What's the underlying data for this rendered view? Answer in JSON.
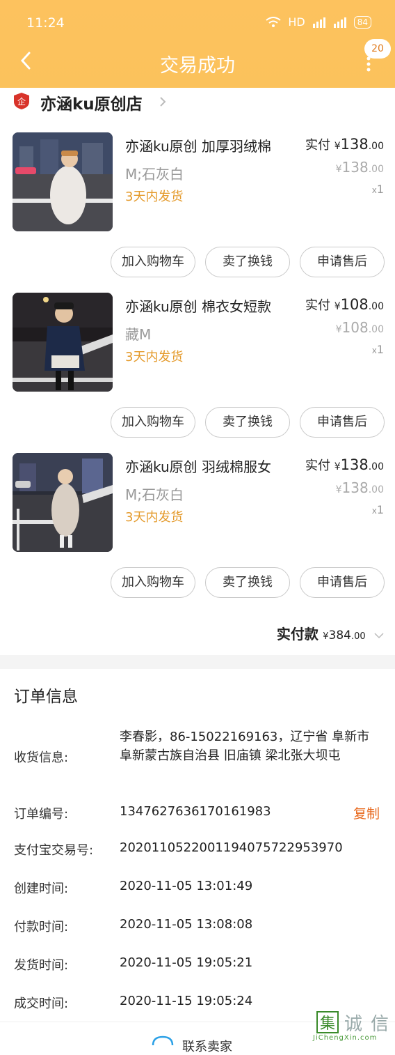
{
  "status_bar": {
    "time": "11:24",
    "network": "HD",
    "battery": "84"
  },
  "header": {
    "title": "交易成功",
    "badge": "20"
  },
  "shop": {
    "name": "亦涵ku原创店"
  },
  "items": [
    {
      "name": "亦涵ku原创 加厚羽绒棉",
      "spec": "M;石灰白",
      "ship": "3天内发货",
      "paid_label": "实付",
      "paid_int": "138",
      "paid_dec": ".00",
      "orig_int": "138",
      "orig_dec": ".00",
      "qty": "1",
      "btn_cart": "加入购物车",
      "btn_sell": "卖了换钱",
      "btn_after": "申请售后"
    },
    {
      "name": "亦涵ku原创 棉衣女短款",
      "spec": "藏M",
      "ship": "3天内发货",
      "paid_label": "实付",
      "paid_int": "108",
      "paid_dec": ".00",
      "orig_int": "108",
      "orig_dec": ".00",
      "qty": "1",
      "btn_cart": "加入购物车",
      "btn_sell": "卖了换钱",
      "btn_after": "申请售后"
    },
    {
      "name": "亦涵ku原创 羽绒棉服女",
      "spec": "M;石灰白",
      "ship": "3天内发货",
      "paid_label": "实付",
      "paid_int": "138",
      "paid_dec": ".00",
      "orig_int": "138",
      "orig_dec": ".00",
      "qty": "1",
      "btn_cart": "加入购物车",
      "btn_sell": "卖了换钱",
      "btn_after": "申请售后"
    }
  ],
  "currency": "¥",
  "qty_prefix": "x",
  "total": {
    "label": "实付款",
    "amount_int": "384",
    "amount_dec": ".00"
  },
  "order_info": {
    "title": "订单信息",
    "address_label": "收货信息:",
    "address": "李春影，86-15022169163，辽宁省 阜新市 阜新蒙古族自治县 旧庙镇 梁北张大坝屯",
    "order_no_label": "订单编号:",
    "order_no": "1347627636170161983",
    "copy": "复制",
    "alipay_label": "支付宝交易号:",
    "alipay_no": "2020110522001194075722953970",
    "created_label": "创建时间:",
    "created": "2020-11-05 13:01:49",
    "paid_label": "付款时间:",
    "paid": "2020-11-05 13:08:08",
    "shipped_label": "发货时间:",
    "shipped": "2020-11-05 19:05:21",
    "done_label": "成交时间:",
    "done": "2020-11-15 19:05:24"
  },
  "footer": {
    "contact": "联系卖家"
  },
  "watermark": {
    "text": "JiChengXin.com"
  },
  "colors": {
    "header": "#fbc25c",
    "ship": "#e49a2b",
    "copy": "#e86a1f"
  }
}
